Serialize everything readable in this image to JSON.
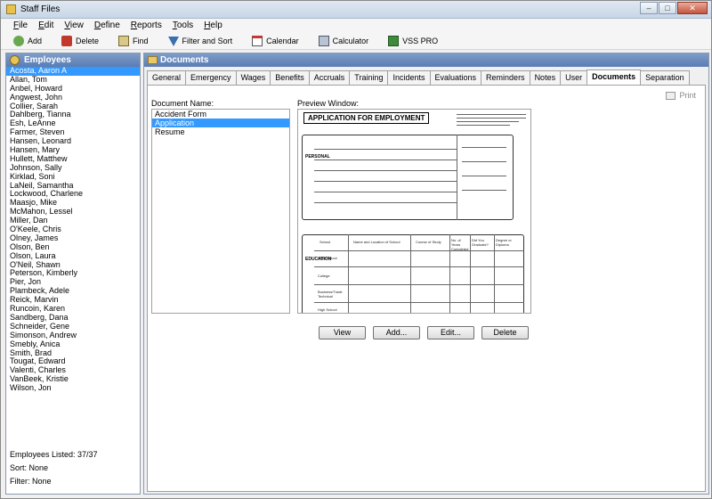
{
  "window": {
    "title": "Staff Files",
    "min": "–",
    "max": "□",
    "close": "✕"
  },
  "menu": [
    {
      "pre": "",
      "u": "F",
      "post": "ile"
    },
    {
      "pre": "",
      "u": "E",
      "post": "dit"
    },
    {
      "pre": "",
      "u": "V",
      "post": "iew"
    },
    {
      "pre": "",
      "u": "D",
      "post": "efine"
    },
    {
      "pre": "",
      "u": "R",
      "post": "eports"
    },
    {
      "pre": "",
      "u": "T",
      "post": "ools"
    },
    {
      "pre": "",
      "u": "H",
      "post": "elp"
    }
  ],
  "toolbar": {
    "add": "Add",
    "delete": "Delete",
    "find": "Find",
    "filter": "Filter and Sort",
    "calendar": "Calendar",
    "calculator": "Calculator",
    "vss": "VSS PRO"
  },
  "employees": {
    "header": "Employees",
    "items": [
      "Acosta, Aaron A",
      "Allan, Tom",
      "Anbel, Howard",
      "Angwest, John",
      "Collier, Sarah",
      "Dahlberg, Tianna",
      "Esh, LeAnne",
      "Farmer, Steven",
      "Hansen, Leonard",
      "Hansen, Mary",
      "Hullett, Matthew",
      "Johnson, Sally",
      "Kirklad, Soni",
      "LaNeil, Samantha",
      "Lockwood, Charlene",
      "Maasjo, Mike",
      "McMahon, Lessel",
      "Miller, Dan",
      "O'Keele, Chris",
      "Olney, James",
      "Olson, Ben",
      "Olson, Laura",
      "O'Neil, Shawn",
      "Peterson, Kimberly",
      "Pier, Jon",
      "Plambeck, Adele",
      "Reick, Marvin",
      "Runcoin, Karen",
      "Sandberg, Dana",
      "Schneider, Gene",
      "Simonson, Andrew",
      "Smebly, Anica",
      "Smith, Brad",
      "Tougat, Edward",
      "Valenti, Charles",
      "VanBeek, Kristie",
      "Wilson, Jon"
    ],
    "selected_index": 0,
    "listed": "Employees Listed: 37/37",
    "sort": "Sort: None",
    "filter": "Filter: None"
  },
  "documents": {
    "header": "Documents",
    "tabs": [
      "General",
      "Emergency",
      "Wages",
      "Benefits",
      "Accruals",
      "Training",
      "Incidents",
      "Evaluations",
      "Reminders",
      "Notes",
      "User",
      "Documents",
      "Separation"
    ],
    "active_tab": "Documents",
    "print": "Print",
    "doc_name_label": "Document Name:",
    "doc_items": [
      "Accident Form",
      "Application",
      "Resume"
    ],
    "doc_selected": 1,
    "preview_label": "Preview Window:",
    "preview": {
      "form_title": "APPLICATION FOR EMPLOYMENT",
      "section1": "PERSONAL",
      "section2": "EDUCATION",
      "col_school": "School",
      "col_name": "Name and Location of School",
      "col_course": "Course of Study",
      "col_years": "No. of Years Completed",
      "col_grad": "Did You Graduate?",
      "col_degree": "Degree or Diploma",
      "row_highschool": "High School",
      "row_college": "College",
      "row_business": "Business/Trade Technical",
      "row_gradschool": "High School"
    },
    "buttons": {
      "view": "View",
      "add": "Add...",
      "edit": "Edit...",
      "delete": "Delete"
    }
  }
}
